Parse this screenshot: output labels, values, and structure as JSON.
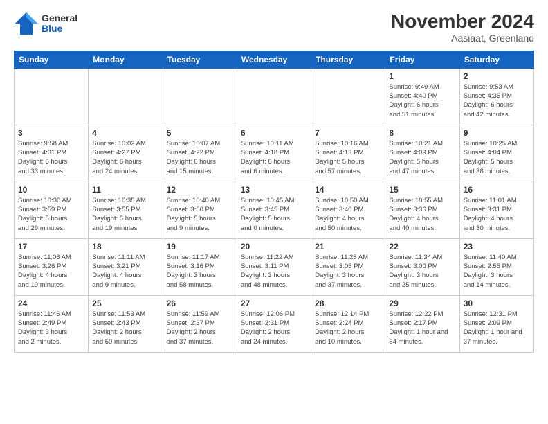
{
  "header": {
    "logo_general": "General",
    "logo_blue": "Blue",
    "month_title": "November 2024",
    "location": "Aasiaat, Greenland"
  },
  "days_of_week": [
    "Sunday",
    "Monday",
    "Tuesday",
    "Wednesday",
    "Thursday",
    "Friday",
    "Saturday"
  ],
  "weeks": [
    [
      {
        "day": "",
        "info": ""
      },
      {
        "day": "",
        "info": ""
      },
      {
        "day": "",
        "info": ""
      },
      {
        "day": "",
        "info": ""
      },
      {
        "day": "",
        "info": ""
      },
      {
        "day": "1",
        "info": "Sunrise: 9:49 AM\nSunset: 4:40 PM\nDaylight: 6 hours\nand 51 minutes."
      },
      {
        "day": "2",
        "info": "Sunrise: 9:53 AM\nSunset: 4:36 PM\nDaylight: 6 hours\nand 42 minutes."
      }
    ],
    [
      {
        "day": "3",
        "info": "Sunrise: 9:58 AM\nSunset: 4:31 PM\nDaylight: 6 hours\nand 33 minutes."
      },
      {
        "day": "4",
        "info": "Sunrise: 10:02 AM\nSunset: 4:27 PM\nDaylight: 6 hours\nand 24 minutes."
      },
      {
        "day": "5",
        "info": "Sunrise: 10:07 AM\nSunset: 4:22 PM\nDaylight: 6 hours\nand 15 minutes."
      },
      {
        "day": "6",
        "info": "Sunrise: 10:11 AM\nSunset: 4:18 PM\nDaylight: 6 hours\nand 6 minutes."
      },
      {
        "day": "7",
        "info": "Sunrise: 10:16 AM\nSunset: 4:13 PM\nDaylight: 5 hours\nand 57 minutes."
      },
      {
        "day": "8",
        "info": "Sunrise: 10:21 AM\nSunset: 4:09 PM\nDaylight: 5 hours\nand 47 minutes."
      },
      {
        "day": "9",
        "info": "Sunrise: 10:25 AM\nSunset: 4:04 PM\nDaylight: 5 hours\nand 38 minutes."
      }
    ],
    [
      {
        "day": "10",
        "info": "Sunrise: 10:30 AM\nSunset: 3:59 PM\nDaylight: 5 hours\nand 29 minutes."
      },
      {
        "day": "11",
        "info": "Sunrise: 10:35 AM\nSunset: 3:55 PM\nDaylight: 5 hours\nand 19 minutes."
      },
      {
        "day": "12",
        "info": "Sunrise: 10:40 AM\nSunset: 3:50 PM\nDaylight: 5 hours\nand 9 minutes."
      },
      {
        "day": "13",
        "info": "Sunrise: 10:45 AM\nSunset: 3:45 PM\nDaylight: 5 hours\nand 0 minutes."
      },
      {
        "day": "14",
        "info": "Sunrise: 10:50 AM\nSunset: 3:40 PM\nDaylight: 4 hours\nand 50 minutes."
      },
      {
        "day": "15",
        "info": "Sunrise: 10:55 AM\nSunset: 3:36 PM\nDaylight: 4 hours\nand 40 minutes."
      },
      {
        "day": "16",
        "info": "Sunrise: 11:01 AM\nSunset: 3:31 PM\nDaylight: 4 hours\nand 30 minutes."
      }
    ],
    [
      {
        "day": "17",
        "info": "Sunrise: 11:06 AM\nSunset: 3:26 PM\nDaylight: 4 hours\nand 19 minutes."
      },
      {
        "day": "18",
        "info": "Sunrise: 11:11 AM\nSunset: 3:21 PM\nDaylight: 4 hours\nand 9 minutes."
      },
      {
        "day": "19",
        "info": "Sunrise: 11:17 AM\nSunset: 3:16 PM\nDaylight: 3 hours\nand 58 minutes."
      },
      {
        "day": "20",
        "info": "Sunrise: 11:22 AM\nSunset: 3:11 PM\nDaylight: 3 hours\nand 48 minutes."
      },
      {
        "day": "21",
        "info": "Sunrise: 11:28 AM\nSunset: 3:05 PM\nDaylight: 3 hours\nand 37 minutes."
      },
      {
        "day": "22",
        "info": "Sunrise: 11:34 AM\nSunset: 3:00 PM\nDaylight: 3 hours\nand 25 minutes."
      },
      {
        "day": "23",
        "info": "Sunrise: 11:40 AM\nSunset: 2:55 PM\nDaylight: 3 hours\nand 14 minutes."
      }
    ],
    [
      {
        "day": "24",
        "info": "Sunrise: 11:46 AM\nSunset: 2:49 PM\nDaylight: 3 hours\nand 2 minutes."
      },
      {
        "day": "25",
        "info": "Sunrise: 11:53 AM\nSunset: 2:43 PM\nDaylight: 2 hours\nand 50 minutes."
      },
      {
        "day": "26",
        "info": "Sunrise: 11:59 AM\nSunset: 2:37 PM\nDaylight: 2 hours\nand 37 minutes."
      },
      {
        "day": "27",
        "info": "Sunrise: 12:06 PM\nSunset: 2:31 PM\nDaylight: 2 hours\nand 24 minutes."
      },
      {
        "day": "28",
        "info": "Sunrise: 12:14 PM\nSunset: 2:24 PM\nDaylight: 2 hours\nand 10 minutes."
      },
      {
        "day": "29",
        "info": "Sunrise: 12:22 PM\nSunset: 2:17 PM\nDaylight: 1 hour and\n54 minutes."
      },
      {
        "day": "30",
        "info": "Sunrise: 12:31 PM\nSunset: 2:09 PM\nDaylight: 1 hour and\n37 minutes."
      }
    ]
  ]
}
